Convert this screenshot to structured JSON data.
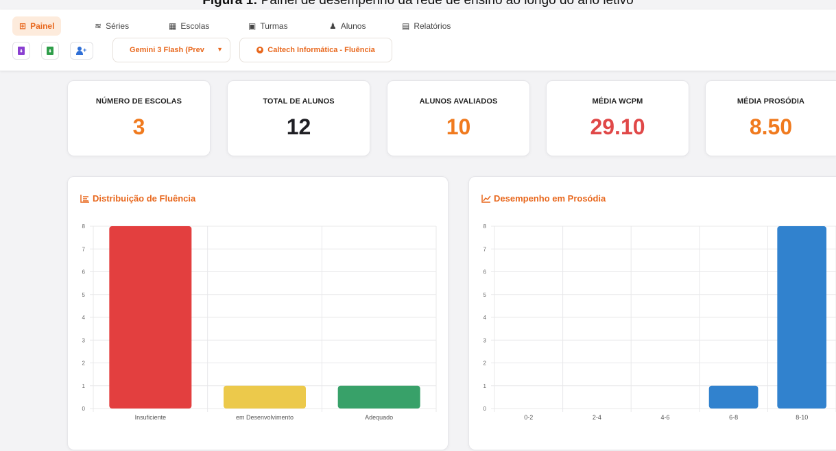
{
  "caption": {
    "prefix": "Figura 1:",
    "text": " Painel de desempenho da rede de ensino ao longo do ano letivo"
  },
  "nav": {
    "items": [
      {
        "label": "Painel",
        "icon": "grid-icon",
        "active": true
      },
      {
        "label": "Séries",
        "icon": "layers-icon",
        "active": false
      },
      {
        "label": "Escolas",
        "icon": "school-icon",
        "active": false
      },
      {
        "label": "Turmas",
        "icon": "class-board-icon",
        "active": false
      },
      {
        "label": "Alunos",
        "icon": "student-icon",
        "active": false
      },
      {
        "label": "Relatórios",
        "icon": "report-file-icon",
        "active": false
      }
    ]
  },
  "toolbar": {
    "model_select": "Gemini 3 Flash (Prev",
    "organization": "Caltech Informática - Fluência"
  },
  "stats": [
    {
      "label": "NÚMERO DE ESCOLAS",
      "value": "3",
      "color": "#f07a1e"
    },
    {
      "label": "TOTAL DE ALUNOS",
      "value": "12",
      "color": "#1f1f24"
    },
    {
      "label": "ALUNOS AVALIADOS",
      "value": "10",
      "color": "#f07a1e"
    },
    {
      "label": "MÉDIA WCPM",
      "value": "29.10",
      "color": "#e04848"
    },
    {
      "label": "MÉDIA PROSÓDIA",
      "value": "8.50",
      "color": "#f07a1e"
    }
  ],
  "chart_data": [
    {
      "type": "bar",
      "title": "Distribuição de Fluência",
      "categories": [
        "Insuficiente",
        "em Desenvolvimento",
        "Adequado"
      ],
      "values": [
        8,
        1,
        1
      ],
      "colors": [
        "#e33f3f",
        "#ecc94b",
        "#38a169"
      ],
      "ylim": [
        0,
        8
      ],
      "yticks": [
        "0",
        "1",
        "2",
        "3",
        "4",
        "5",
        "6",
        "7",
        "8"
      ],
      "grid": true
    },
    {
      "type": "bar",
      "title": "Desempenho em Prosódia",
      "categories": [
        "0-2",
        "2-4",
        "4-6",
        "6-8",
        "8-10"
      ],
      "values": [
        0,
        0,
        0,
        1,
        8
      ],
      "colors": [
        "#3182ce"
      ],
      "ylim": [
        0,
        8
      ],
      "yticks": [
        "0",
        "1",
        "2",
        "3",
        "4",
        "5",
        "6",
        "7",
        "8"
      ],
      "grid": true
    }
  ]
}
